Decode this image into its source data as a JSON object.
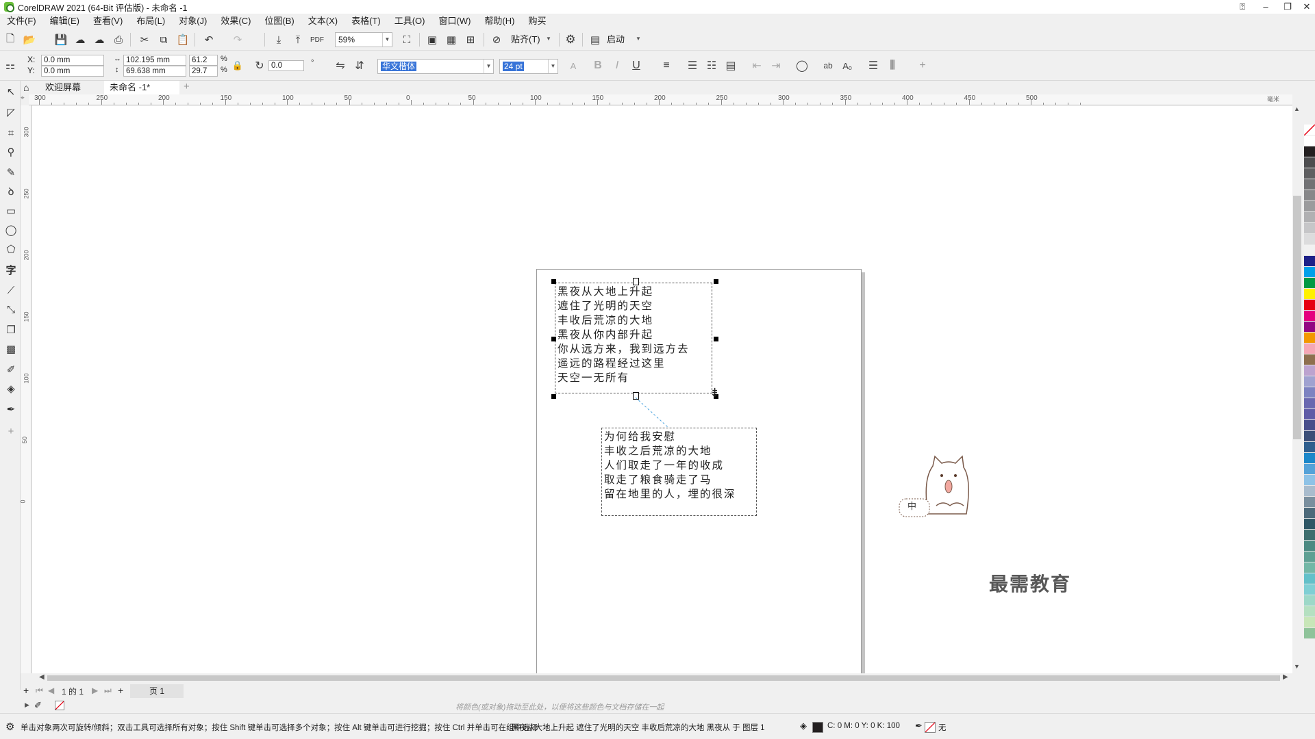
{
  "window": {
    "title": "CorelDRAW 2021 (64-Bit 评估版) - 未命名 -1",
    "controls": {
      "minimize": "–",
      "restore": "❐",
      "close": "✕",
      "help": "⍰"
    }
  },
  "menu": [
    "文件(F)",
    "编辑(E)",
    "查看(V)",
    "布局(L)",
    "对象(J)",
    "效果(C)",
    "位图(B)",
    "文本(X)",
    "表格(T)",
    "工具(O)",
    "窗口(W)",
    "帮助(H)",
    "购买"
  ],
  "standard_toolbar": {
    "zoom": "59%",
    "snap_label": "贴齐(T)",
    "launch_label": "启动"
  },
  "property_bar": {
    "x_label": "X:",
    "x_value": "0.0 mm",
    "y_label": "Y:",
    "y_value": "0.0 mm",
    "width": "102.195 mm",
    "height": "69.638 mm",
    "scale_w": "61.2",
    "scale_h": "29.7",
    "percent": "%",
    "rotation": "0.0",
    "degree": "°",
    "font_name": "华文楷体",
    "font_size": "24 pt",
    "bold": "B",
    "italic": "I",
    "underline": "U"
  },
  "tabs": [
    {
      "label": "欢迎屏幕",
      "active": false
    },
    {
      "label": "未命名 -1*",
      "active": true
    }
  ],
  "ruler": {
    "unit": "毫米",
    "h_ticks": [
      "300",
      "250",
      "200",
      "150",
      "100",
      "50",
      "0",
      "50",
      "100",
      "150",
      "200",
      "250",
      "300",
      "350",
      "400",
      "450",
      "500"
    ],
    "v_ticks": [
      "300",
      "250",
      "200",
      "150",
      "100",
      "50",
      "0"
    ]
  },
  "document": {
    "frame1_lines": [
      "黑夜从大地上升起",
      "遮住了光明的天空",
      "丰收后荒凉的大地",
      "黑夜从你内部升起",
      "你从远方来，我到远方去",
      "遥远的路程经过这里",
      "天空一无所有"
    ],
    "frame2_lines": [
      "为何给我安慰",
      "丰收之后荒凉的大地",
      "人们取走了一年的收成",
      "取走了粮食骑走了马",
      "留在地里的人，埋的很深"
    ]
  },
  "mascot": {
    "badge": "中"
  },
  "page_nav": {
    "current": "1",
    "of_label": "的",
    "total": "1",
    "page_tab": "页 1"
  },
  "hint_text": "将颜色(或对象)拖动至此处，以便将这些颜色与文档存储在一起",
  "status": {
    "message": "单击对象两次可旋转/倾斜；双击工具可选择所有对象；按住 Shift 键单击可选择多个对象；按住 Alt 键单击可进行挖掘；按住 Ctrl 并单击可在组中选择",
    "selection": "黑夜从大地上升起 遮住了光明的天空 丰收后荒凉的大地 黑夜从 于 图层 1",
    "fill_values": "C: 0 M: 0 Y: 0 K: 100",
    "outline": "无"
  },
  "watermark": "最需教育",
  "colors": {
    "accent": "#3874d8",
    "connector": "#4aa3df",
    "palette": [
      "#ffffff",
      "#231f20",
      "#4d4d4f",
      "#5f5f61",
      "#727274",
      "#878789",
      "#9b9b9d",
      "#b0b0b2",
      "#c6c6c8",
      "#dcdcdd",
      "#f1f1f1",
      "#1d2088",
      "#00a0e9",
      "#009944",
      "#fff100",
      "#e60012",
      "#e4007f",
      "#920783",
      "#f39800",
      "#f5a7b5",
      "#8e6f4e",
      "#bca3cf",
      "#a0a2d0",
      "#7d83c1",
      "#6a68b0",
      "#5f5ba6",
      "#484e8b",
      "#3c4f78",
      "#2f5f8e",
      "#1b87c9",
      "#55a2d8",
      "#8ec2e6",
      "#a9bccd",
      "#7a8f9e",
      "#4d6a7a",
      "#2f5766",
      "#3e6e6e",
      "#4c8a82",
      "#5fa093",
      "#73b7a6",
      "#62c0c9",
      "#7fcfd4",
      "#9dd8c8",
      "#b5e0c1",
      "#c8e6b8",
      "#8fc39a"
    ]
  }
}
